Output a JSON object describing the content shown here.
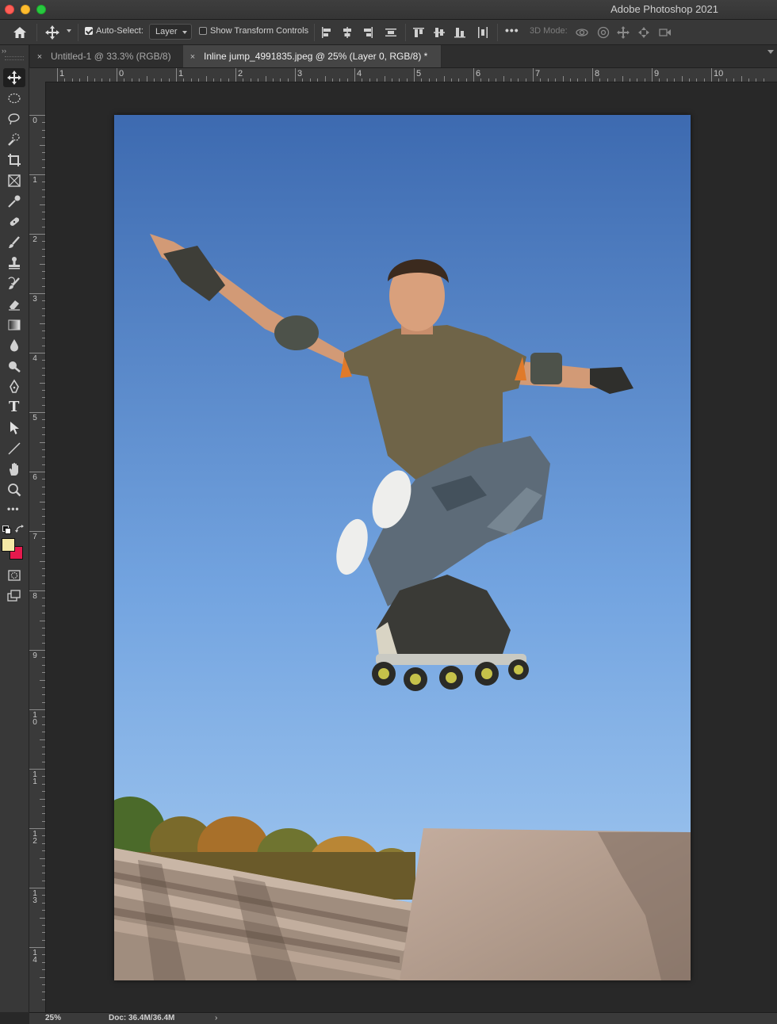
{
  "window": {
    "title": "Adobe Photoshop 2021"
  },
  "options_bar": {
    "auto_select_label": "Auto-Select:",
    "auto_select_checked": true,
    "auto_select_target": "Layer",
    "show_transform_label": "Show Transform Controls",
    "show_transform_checked": false,
    "more_label": "•••",
    "three_d_mode_label": "3D Mode:"
  },
  "tabs": [
    {
      "label": "Untitled-1 @ 33.3% (RGB/8)",
      "active": false,
      "close": "×"
    },
    {
      "label": "Inline jump_4991835.jpeg @ 25% (Layer 0, RGB/8) *",
      "active": true,
      "close": "×"
    }
  ],
  "toolbar": {
    "collapse_glyph": "››",
    "tools": [
      "move-tool",
      "marquee-tool",
      "lasso-tool",
      "quick-selection-tool",
      "crop-tool",
      "frame-tool",
      "eyedropper-tool",
      "healing-brush-tool",
      "brush-tool",
      "clone-stamp-tool",
      "history-brush-tool",
      "eraser-tool",
      "gradient-tool",
      "blur-tool",
      "dodge-tool",
      "pen-tool",
      "type-tool",
      "path-selection-tool",
      "line-tool",
      "hand-tool",
      "zoom-tool",
      "edit-toolbar"
    ],
    "type_glyph": "T",
    "more_glyph": "•••",
    "foreground_color": "#f5e9a6",
    "background_color": "#e5194d"
  },
  "ruler_h_labels": [
    "1",
    "0",
    "1",
    "2",
    "3",
    "4",
    "5",
    "6",
    "7",
    "8",
    "9",
    "10"
  ],
  "ruler_v_labels": [
    "0",
    "1",
    "2",
    "3",
    "4",
    "5",
    "6",
    "7",
    "8",
    "9",
    "10",
    "11",
    "12",
    "13",
    "14"
  ],
  "status": {
    "zoom": "25%",
    "doc": "Doc: 36.4M/36.4M",
    "arrow": "›"
  },
  "colors": {
    "sky_top": "#3d6ab0",
    "sky_bottom": "#a8cdf2",
    "shirt": "#6f6448",
    "stone": "#b8a294"
  }
}
